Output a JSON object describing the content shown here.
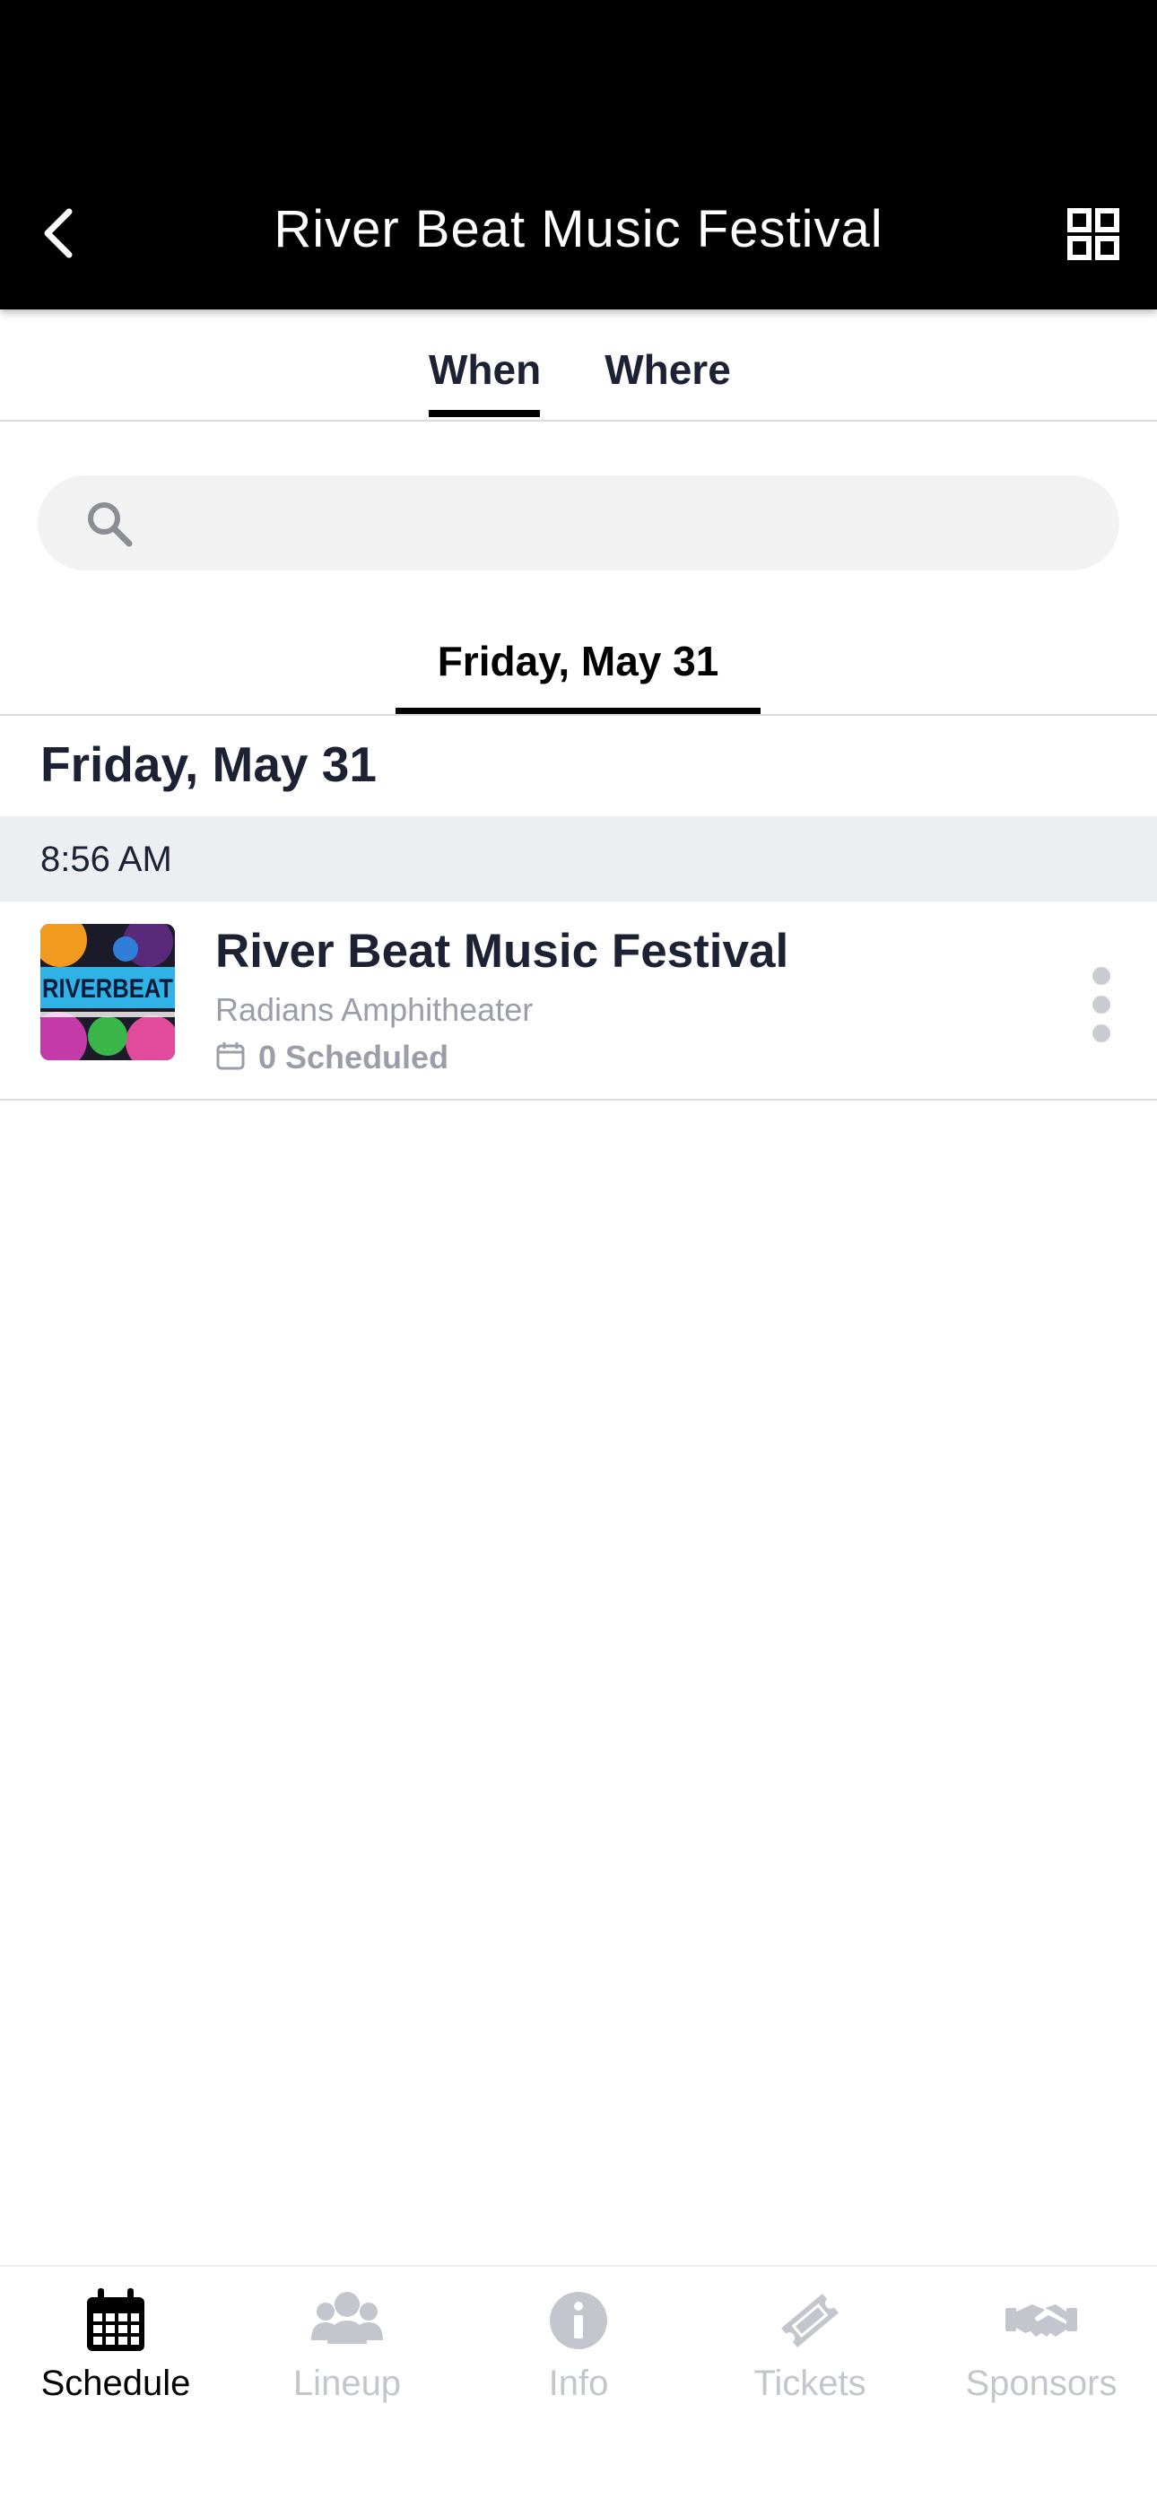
{
  "header": {
    "title": "River Beat Music Festival",
    "back_icon": "chevron-left-icon",
    "menu_icon": "grid-icon"
  },
  "tabs": [
    {
      "label": "When",
      "active": true
    },
    {
      "label": "Where",
      "active": false
    }
  ],
  "search": {
    "placeholder": "",
    "value": "",
    "icon": "search-icon"
  },
  "day_tabs": [
    {
      "label": "Friday, May 31",
      "active": true
    }
  ],
  "schedule": {
    "date_heading": "Friday, May 31",
    "time_slot": "8:56 AM",
    "event": {
      "title": "River Beat Music Festival",
      "venue": "Radians Amphitheater",
      "scheduled": "0 Scheduled",
      "thumb_text": "RIVERBEAT"
    }
  },
  "bottom_nav": [
    {
      "label": "Schedule",
      "icon": "calendar-icon",
      "active": true
    },
    {
      "label": "Lineup",
      "icon": "users-icon",
      "active": false
    },
    {
      "label": "Info",
      "icon": "info-icon",
      "active": false
    },
    {
      "label": "Tickets",
      "icon": "ticket-icon",
      "active": false
    },
    {
      "label": "Sponsors",
      "icon": "handshake-icon",
      "active": false
    }
  ],
  "colors": {
    "header_bg": "#000000",
    "text_primary": "#1c2233",
    "text_muted": "#9a9ea8",
    "nav_inactive": "#c3c6cc"
  }
}
